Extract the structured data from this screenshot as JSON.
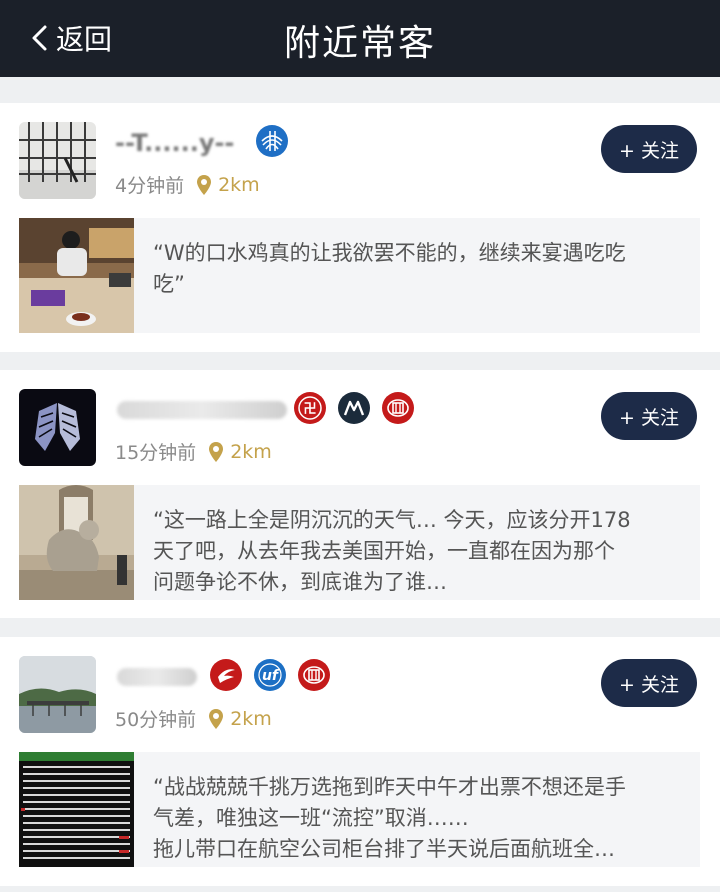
{
  "nav": {
    "back_label": "返回",
    "title": "附近常客"
  },
  "follow_label": "+ 关注",
  "cards": [
    {
      "name_visible": "--T......y--",
      "time": "4分钟前",
      "distance": "2km",
      "badges": [
        "united-airlines-icon"
      ],
      "quote_lines": [
        "“W的口水鸡真的让我欲罢不能的，继续来宴遇吃吃",
        "吃”"
      ]
    },
    {
      "name_visible": "",
      "time": "15分钟前",
      "distance": "2km",
      "badges": [
        "hilton-red-icon",
        "marriott-icon",
        "hilton-honors-icon"
      ],
      "quote_lines": [
        "“这一路上全是阴沉沉的天气… 今天，应该分开178",
        "天了吧，从去年我去美国开始，一直都在因为那个",
        "问题争论不休，到底谁为了谁…"
      ]
    },
    {
      "name_visible": "",
      "time": "50分钟前",
      "distance": "2km",
      "badges": [
        "china-eastern-icon",
        "china-southern-icon",
        "hilton-honors-icon"
      ],
      "quote_lines": [
        "“战战兢兢千挑万选拖到昨天中午才出票不想还是手",
        "气差，唯独这一班“流控”取消……",
        "拖儿带口在航空公司柜台排了半天说后面航班全…"
      ]
    }
  ],
  "colors": {
    "nav_bg": "#1b2029",
    "follow_bg": "#1d2b48",
    "distance": "#c4a24b",
    "page_bg": "#eef0f2"
  }
}
